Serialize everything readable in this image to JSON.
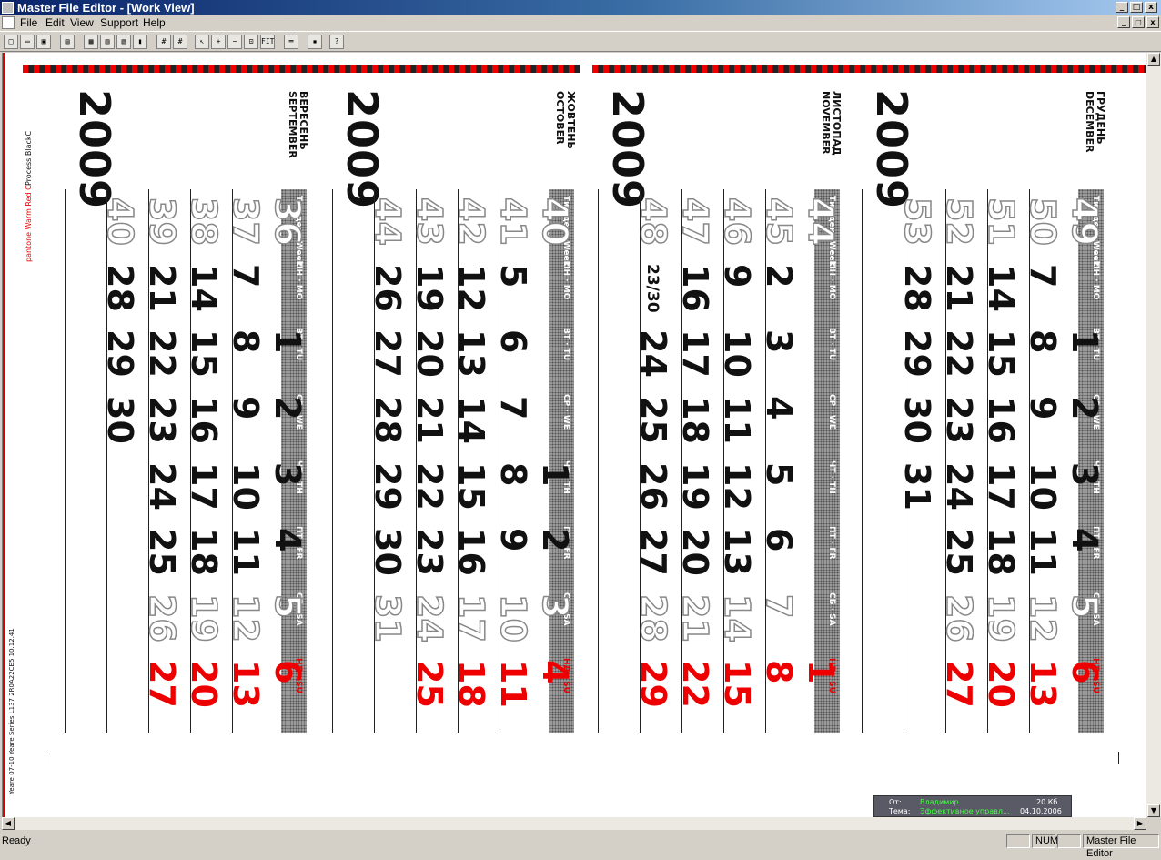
{
  "window": {
    "title": "Master File Editor - [Work View]",
    "min": "_",
    "max": "□",
    "close": "x"
  },
  "menu": {
    "items": [
      "File",
      "Edit",
      "View",
      "Support",
      "Help"
    ],
    "mdi_min": "_",
    "mdi_max": "□",
    "mdi_close": "x"
  },
  "toolbar": {
    "buttons": [
      {
        "icon": "new-icon",
        "glyph": "□"
      },
      {
        "icon": "open-icon",
        "glyph": "▭"
      },
      {
        "icon": "save-icon",
        "glyph": "▣"
      },
      {
        "icon": "preview-icon",
        "glyph": "▤"
      },
      {
        "icon": "layout1-icon",
        "glyph": "▦"
      },
      {
        "icon": "layout2-icon",
        "glyph": "▥"
      },
      {
        "icon": "layout3-icon",
        "glyph": "▧"
      },
      {
        "icon": "trash-icon",
        "glyph": "▮"
      },
      {
        "icon": "grid1-icon",
        "glyph": "#"
      },
      {
        "icon": "grid2-icon",
        "glyph": "#"
      },
      {
        "icon": "pointer-icon",
        "glyph": "↖"
      },
      {
        "icon": "zoom-in-icon",
        "glyph": "+"
      },
      {
        "icon": "zoom-out-icon",
        "glyph": "−"
      },
      {
        "icon": "zoom-rect-icon",
        "glyph": "⊡"
      },
      {
        "icon": "fit-icon",
        "glyph": "FIT"
      },
      {
        "icon": "ruler-icon",
        "glyph": "═"
      },
      {
        "icon": "color-icon",
        "glyph": "▪"
      },
      {
        "icon": "help-icon",
        "glyph": "?"
      }
    ]
  },
  "canvas": {
    "side_text_red": "pantone Warm Red C",
    "side_text_black": "Process BlackC",
    "side_note": "Yeare 07-10  Yeare Series  L137  2R0A22CE5  10.12.41",
    "headers": [
      "Тиждень Week",
      "ПН · MO",
      "ВТ · TU",
      "СР · WE",
      "ЧТ · TH",
      "ПТ · FR",
      "СБ · SA",
      "НД · SU"
    ],
    "months": [
      {
        "name": "ГРУДЕНЬ\nDECEMBER",
        "year": "2009",
        "weeks": [
          [
            "49",
            "",
            "1",
            "2",
            "3",
            "4",
            "5",
            "6"
          ],
          [
            "50",
            "7",
            "8",
            "9",
            "10",
            "11",
            "12",
            "13"
          ],
          [
            "51",
            "14",
            "15",
            "16",
            "17",
            "18",
            "19",
            "20"
          ],
          [
            "52",
            "21",
            "22",
            "23",
            "24",
            "25",
            "26",
            "27"
          ],
          [
            "53",
            "28",
            "29",
            "30",
            "31",
            "",
            "",
            ""
          ]
        ]
      },
      {
        "name": "ЛИСТОПАД\nNOVEMBER",
        "year": "2009",
        "weeks": [
          [
            "44",
            "",
            "",
            "",
            "",
            "",
            "",
            "1"
          ],
          [
            "45",
            "2",
            "3",
            "4",
            "5",
            "6",
            "7",
            "8"
          ],
          [
            "46",
            "9",
            "10",
            "11",
            "12",
            "13",
            "14",
            "15"
          ],
          [
            "47",
            "16",
            "17",
            "18",
            "19",
            "20",
            "21",
            "22"
          ],
          [
            "48",
            "23/30",
            "24",
            "25",
            "26",
            "27",
            "28",
            "29"
          ]
        ]
      },
      {
        "name": "ЖОВТЕНЬ\nOCTOBER",
        "year": "2009",
        "weeks": [
          [
            "40",
            "",
            "",
            "",
            "1",
            "2",
            "3",
            "4"
          ],
          [
            "41",
            "5",
            "6",
            "7",
            "8",
            "9",
            "10",
            "11"
          ],
          [
            "42",
            "12",
            "13",
            "14",
            "15",
            "16",
            "17",
            "18"
          ],
          [
            "43",
            "19",
            "20",
            "21",
            "22",
            "23",
            "24",
            "25"
          ],
          [
            "44",
            "26",
            "27",
            "28",
            "29",
            "30",
            "31",
            ""
          ]
        ]
      },
      {
        "name": "ВЕРЕСЕНЬ\nSEPTEMBER",
        "year": "2009",
        "weeks": [
          [
            "36",
            "",
            "1",
            "2",
            "3",
            "4",
            "5",
            "6"
          ],
          [
            "37",
            "7",
            "8",
            "9",
            "10",
            "11",
            "12",
            "13"
          ],
          [
            "38",
            "14",
            "15",
            "16",
            "17",
            "18",
            "19",
            "20"
          ],
          [
            "39",
            "21",
            "22",
            "23",
            "24",
            "25",
            "26",
            "27"
          ],
          [
            "40",
            "28",
            "29",
            "30",
            "",
            "",
            "",
            ""
          ]
        ]
      }
    ]
  },
  "notification": {
    "from_label": "От:",
    "from": "Владимир",
    "size": "20 Кб",
    "subject_label": "Тема:",
    "subject": "Эффективное управл...",
    "date": "04.10.2006"
  },
  "status": {
    "text": "Ready",
    "num": "NUM",
    "app": "Master File Editor"
  },
  "colors": {
    "red": "#e00000",
    "black": "#111111",
    "accent": "#0a246a"
  }
}
